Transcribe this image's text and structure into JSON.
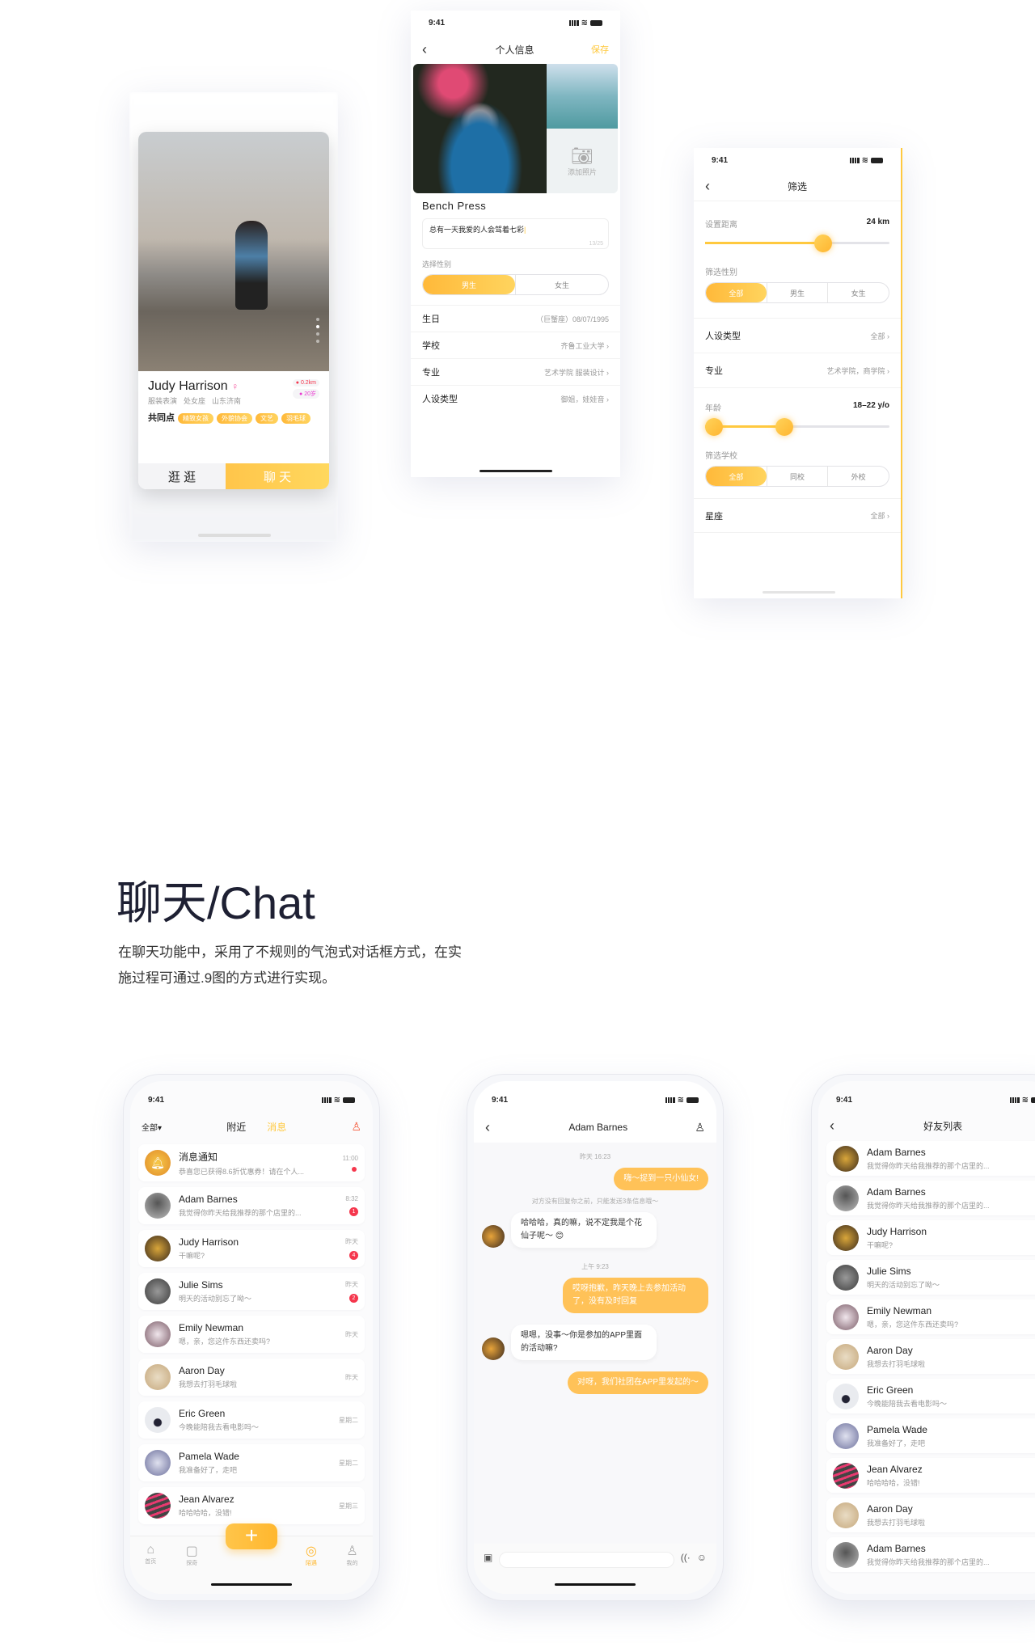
{
  "status_time": "9:41",
  "card_screen": {
    "name": "Judy Harrison",
    "info": [
      "服装表演",
      "处女座",
      "山东济南"
    ],
    "distance": "0.2km",
    "age": "20岁",
    "common_label": "共同点",
    "tags": [
      "精致女孩",
      "外貌协会",
      "文艺",
      "羽毛球"
    ],
    "left_btn": "逛 逛",
    "right_btn": "聊 天",
    "photo_index": 2,
    "photo_count": 4
  },
  "profile_screen": {
    "title": "个人信息",
    "save": "保存",
    "add_photo": "添加照片",
    "name": "Bench Press",
    "bio": "总有一天我爱的人会驾着七彩",
    "bio_count": "13/25",
    "gender_label": "选择性别",
    "gender_options": [
      "男生",
      "女生"
    ],
    "rows": [
      {
        "k": "生日",
        "v": "（巨蟹座）08/07/1995"
      },
      {
        "k": "学校",
        "v": "齐鲁工业大学"
      },
      {
        "k": "专业",
        "v": "艺术学院  服装设计"
      },
      {
        "k": "人设类型",
        "v": "御姐，娃娃音"
      }
    ]
  },
  "filter_screen": {
    "title": "筛选",
    "distance_label": "设置距离",
    "distance_value": "24 km",
    "distance_fraction": 0.64,
    "gender_label": "筛选性别",
    "gender_options": [
      "全部",
      "男生",
      "女生"
    ],
    "rows1": [
      {
        "k": "人设类型",
        "v": "全部"
      },
      {
        "k": "专业",
        "v": "艺术学院，商学院"
      }
    ],
    "age_label": "年龄",
    "age_value": "18–22  y/o",
    "age_range_fraction": [
      0.0,
      0.43
    ],
    "school_label": "筛选学校",
    "school_options": [
      "全部",
      "同校",
      "外校"
    ],
    "zodiac": {
      "k": "星座",
      "v": "全部"
    },
    "accent": "#ffc93f"
  },
  "section": {
    "title": "聊天/Chat",
    "desc1": "在聊天功能中，采用了不规则的气泡式对话框方式，在实",
    "desc2": "施过程可通过.9图的方式进行实现。"
  },
  "messages_screen": {
    "filter": "全部",
    "tabs": [
      "附近",
      "消息"
    ],
    "active_tab": "消息",
    "items": [
      {
        "name": "消息通知",
        "preview": "恭喜您已获得8.6折优惠券！请在个人...",
        "time": "11:00",
        "badge": ""
      },
      {
        "name": "Adam Barnes",
        "preview": "我觉得你昨天给我推荐的那个店里的...",
        "time": "8:32",
        "badge": "1"
      },
      {
        "name": "Judy Harrison",
        "preview": "干嘛呢?",
        "time": "昨天",
        "badge": "4"
      },
      {
        "name": "Julie Sims",
        "preview": "明天的活动别忘了呦～",
        "time": "昨天",
        "badge": "2"
      },
      {
        "name": "Emily Newman",
        "preview": "嗯，亲，您这件东西还卖吗?",
        "time": "昨天",
        "badge": ""
      },
      {
        "name": "Aaron Day",
        "preview": "我想去打羽毛球啦",
        "time": "昨天",
        "badge": ""
      },
      {
        "name": "Eric Green",
        "preview": "今晚能陪我去看电影吗～",
        "time": "星期二",
        "badge": ""
      },
      {
        "name": "Pamela Wade",
        "preview": "我准备好了，走吧",
        "time": "星期二",
        "badge": ""
      },
      {
        "name": "Jean Alvarez",
        "preview": "哈哈哈哈，没错!",
        "time": "星期三",
        "badge": ""
      }
    ],
    "tabbar": [
      "首页",
      "探奇",
      "陌遇",
      "我的"
    ],
    "active": "陌遇"
  },
  "chat_screen": {
    "title": "Adam Barnes",
    "ts1": "昨天 16:23",
    "m1": "嗨～捉到一只小仙女!",
    "notice": "对方没有回复你之前，只能发送3条信息哦～",
    "m2": "哈哈哈，真的嘛，说不定我是个花仙子呢～ 😊",
    "ts2": "上午 9:23",
    "m3": "哎呀抱歉，昨天晚上去参加活动了，没有及时回复",
    "m4": "嗯嗯，没事～你是参加的APP里面的活动嘛?",
    "m5": "对呀，我们社团在APP里发起的～"
  },
  "friends_screen": {
    "title": "好友列表",
    "items": [
      {
        "name": "Adam Barnes",
        "preview": "我觉得你昨天给我推荐的那个店里的...",
        "online": true
      },
      {
        "name": "Adam Barnes",
        "preview": "我觉得你昨天给我推荐的那个店里的...",
        "online": true
      },
      {
        "name": "Judy Harrison",
        "preview": "干嘛呢?",
        "online": true
      },
      {
        "name": "Julie Sims",
        "preview": "明天的活动别忘了呦～",
        "online": false
      },
      {
        "name": "Emily Newman",
        "preview": "嗯，亲，您这件东西还卖吗?",
        "online": false
      },
      {
        "name": "Aaron Day",
        "preview": "我想去打羽毛球啦",
        "online": false
      },
      {
        "name": "Eric Green",
        "preview": "今晚能陪我去看电影吗～",
        "online": false
      },
      {
        "name": "Pamela Wade",
        "preview": "我准备好了，走吧",
        "online": false
      },
      {
        "name": "Jean Alvarez",
        "preview": "哈哈哈哈，没错!",
        "online": false
      },
      {
        "name": "Aaron Day",
        "preview": "我想去打羽毛球啦",
        "online": false
      },
      {
        "name": "Adam Barnes",
        "preview": "我觉得你昨天给我推荐的那个店里的...",
        "online": true
      }
    ]
  }
}
